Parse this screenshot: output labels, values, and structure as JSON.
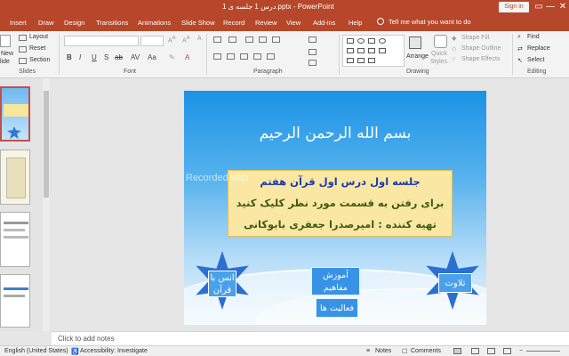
{
  "window": {
    "title": "درس 1 جلسه ی 1.pptx - PowerPoint",
    "signin": "Sign in",
    "minimize": "—",
    "restore": "❐",
    "close": "✕"
  },
  "tabs": [
    "Insert",
    "Draw",
    "Design",
    "Transitions",
    "Animations",
    "Slide Show",
    "Record",
    "Review",
    "View",
    "Add-ins",
    "Help"
  ],
  "tell_me": "Tell me what you want to do",
  "ribbon": {
    "new_slide": "New",
    "new_slide2": "lide",
    "layout": "Layout",
    "reset": "Reset",
    "section": "Section",
    "groups": {
      "slides": "Slides",
      "font": "Font",
      "paragraph": "Paragraph",
      "drawing": "Drawing",
      "editing": "Editing"
    },
    "format_buttons": [
      "B",
      "I",
      "U",
      "S",
      "ab",
      "AV",
      "Aa"
    ],
    "arrange": "Arrange",
    "quick_styles": "Quick",
    "quick_styles2": "Styles",
    "shape_fill": "Shape Fill",
    "shape_outline": "Shape Outline",
    "shape_effects": "Shape Effects",
    "find": "Find",
    "replace": "Replace",
    "select": "Select"
  },
  "slide": {
    "title": "بسم الله الرحمن الرحیم",
    "line1": "جلسه اول درس اول قرآن هفتم",
    "line2": "برای رفتن به قسمت مورد نظر کلیک کنید",
    "line3": "تهیه کننده : امیرصدرا جعفری بابوکانی",
    "watermark": "Recorded with",
    "btn_quran": "انس با قرآن",
    "btn_concepts": "آموزش مفاهیم",
    "btn_activities": "فعالیت ها",
    "btn_recitation": "تلاوت"
  },
  "notes_placeholder": "Click to add notes",
  "status": {
    "language": "English (United States)",
    "accessibility": "Accessibility: Investigate",
    "notes": "Notes",
    "comments": "Comments"
  }
}
